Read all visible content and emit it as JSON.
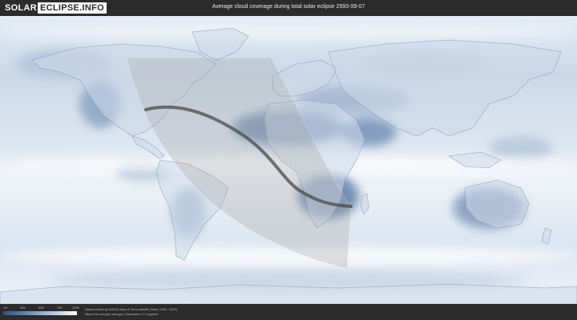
{
  "header": {
    "logo_left": "SOLAR",
    "logo_right": "ECLIPSE.INFO",
    "title": "Average cloud coverage during total solar eclipse 2993-09-07"
  },
  "legend": {
    "ticks": [
      "0%",
      "25%",
      "50%",
      "75%",
      "100%"
    ],
    "colors": [
      "#31547e",
      "#5a7aa3",
      "#8fa8c6",
      "#c4d3e4",
      "#ffffff"
    ]
  },
  "credits": {
    "line1": "Data provided by NASA's Aqua & Terra satellite (Years: 2000 - 2019)",
    "line2": "https://neo.sci.gsfc.nasa.gov | Resolution: 0.1 degrees"
  }
}
